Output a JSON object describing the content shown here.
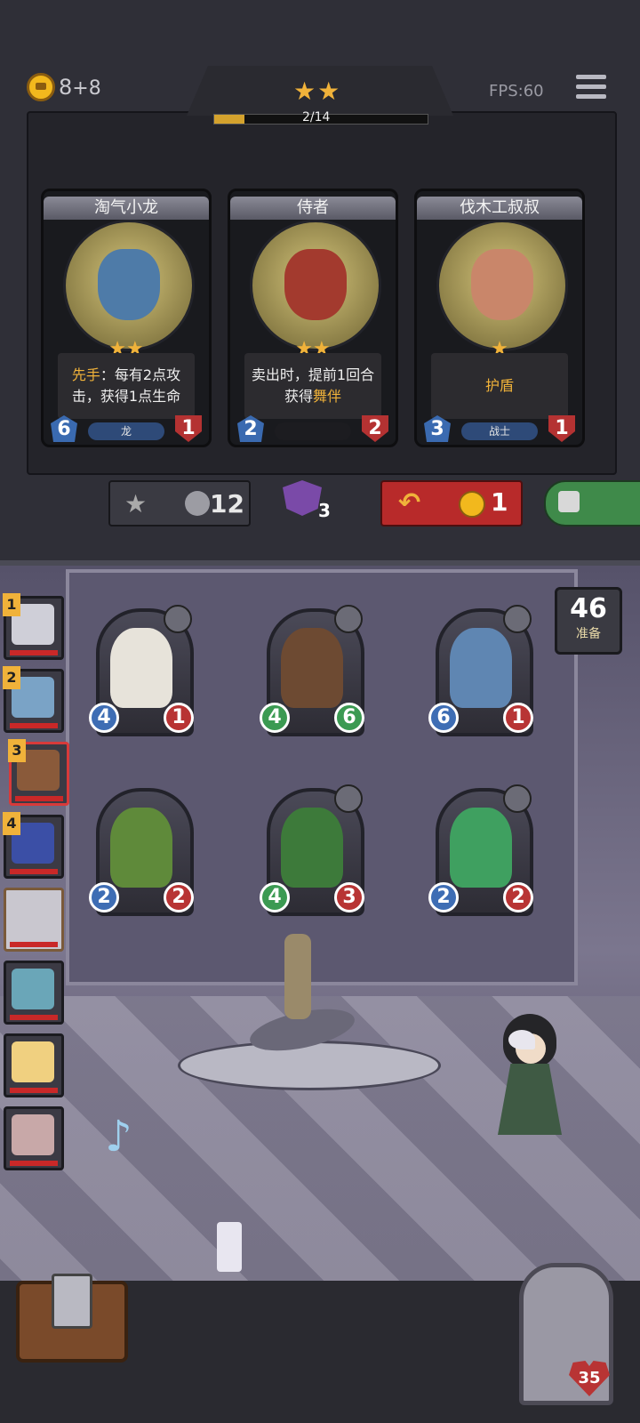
{
  "hud": {
    "gold": "8",
    "gold_income": "+8",
    "fps": "FPS:60",
    "tier_stars": "★★",
    "progress_label": "2/14",
    "progress_fraction": 0.14
  },
  "shop": [
    {
      "name": "淘气小龙",
      "stars": "★★",
      "ability_prefix": "先手",
      "ability": "：每有2点攻击，获得1点生命",
      "attack": "6",
      "health": "1",
      "tribe": "龙",
      "portrait_color": "#4e7ba8"
    },
    {
      "name": "侍者",
      "stars": "★★",
      "ability_prefix": "",
      "ability": "卖出时，提前1回合获得",
      "ability_suffix": "舞伴",
      "attack": "2",
      "health": "2",
      "tribe": "",
      "portrait_color": "#a33a2e"
    },
    {
      "name": "伐木工叔叔",
      "stars": "★",
      "ability_prefix": "",
      "ability": "护盾",
      "attack": "3",
      "health": "1",
      "tribe": "战士",
      "portrait_color": "#c9866a"
    }
  ],
  "actions": {
    "upgrade_cost": "12",
    "mask_count": "3",
    "refresh_cost": "1"
  },
  "turn": {
    "value": "46",
    "label": "准备"
  },
  "board": [
    {
      "attack": "4",
      "health": "1",
      "color": "#e7e3da"
    },
    {
      "attack": "4",
      "health": "6",
      "color": "#6d4a32",
      "attack_buffed": true,
      "health_buffed": true
    },
    {
      "attack": "6",
      "health": "1",
      "color": "#5f86b2"
    },
    {
      "attack": "2",
      "health": "2",
      "color": "#5f8a3a"
    },
    {
      "attack": "4",
      "health": "3",
      "color": "#3d7a3a",
      "attack_buffed": true
    },
    {
      "attack": "2",
      "health": "2",
      "color": "#3fa060"
    }
  ],
  "opponents": [
    {
      "rank": "1",
      "color": "#cfcfd8"
    },
    {
      "rank": "2",
      "color": "#7aa3c6"
    },
    {
      "rank": "3",
      "color": "#8a5a3a",
      "selected": true
    },
    {
      "rank": "4",
      "color": "#3b4fa6"
    },
    {
      "rank": "",
      "color": "",
      "empty": true
    },
    {
      "rank": "",
      "color": "#6aa6b8"
    },
    {
      "rank": "",
      "color": "#f0d080"
    },
    {
      "rank": "",
      "color": "#c8a8a8"
    }
  ],
  "player": {
    "health": "35"
  }
}
